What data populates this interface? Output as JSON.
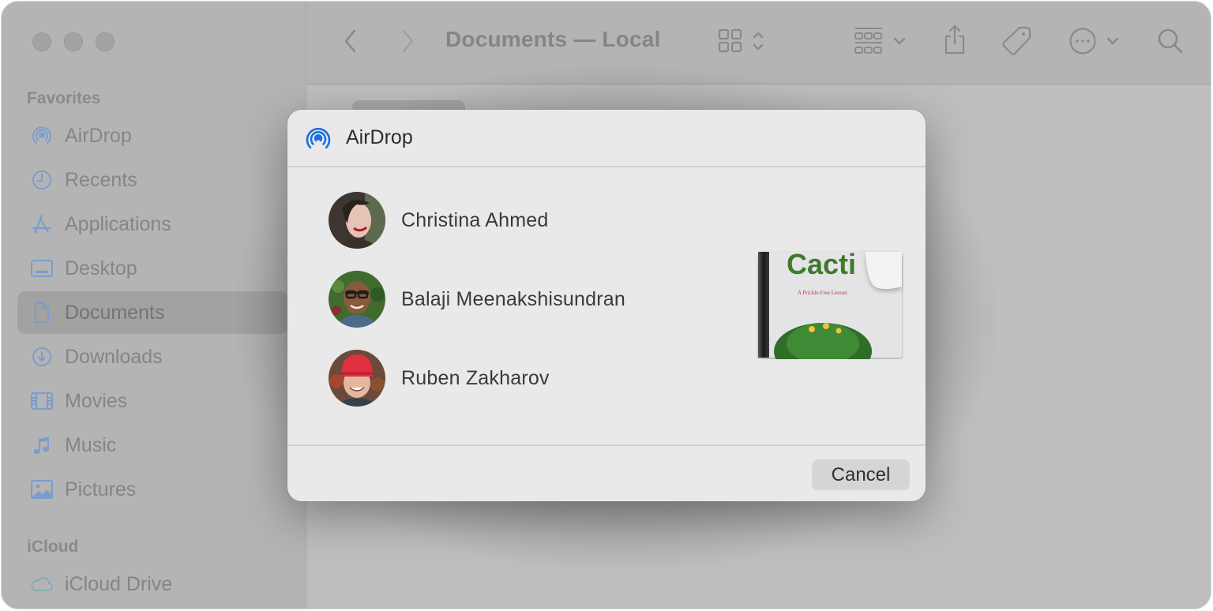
{
  "window": {
    "title": "Documents — Local",
    "traffic_lights": [
      "close",
      "minimize",
      "zoom"
    ]
  },
  "sidebar": {
    "sections": [
      {
        "label": "Favorites",
        "items": [
          {
            "label": "AirDrop",
            "icon": "airdrop-icon",
            "selected": false
          },
          {
            "label": "Recents",
            "icon": "clock-icon",
            "selected": false
          },
          {
            "label": "Applications",
            "icon": "applications-icon",
            "selected": false
          },
          {
            "label": "Desktop",
            "icon": "desktop-icon",
            "selected": false
          },
          {
            "label": "Documents",
            "icon": "document-icon",
            "selected": true
          },
          {
            "label": "Downloads",
            "icon": "download-icon",
            "selected": false
          },
          {
            "label": "Movies",
            "icon": "film-icon",
            "selected": false
          },
          {
            "label": "Music",
            "icon": "music-note-icon",
            "selected": false
          },
          {
            "label": "Pictures",
            "icon": "photo-icon",
            "selected": false
          }
        ]
      },
      {
        "label": "iCloud",
        "items": [
          {
            "label": "iCloud Drive",
            "icon": "cloud-icon",
            "selected": false
          }
        ]
      }
    ]
  },
  "toolbar": {
    "back": "chevron-left-icon",
    "forward": "chevron-right-icon",
    "view_mode": "grid-icon",
    "group_by": "group-icon",
    "share": "share-icon",
    "tags": "tag-icon",
    "more": "ellipsis-circle-icon",
    "search": "search-icon"
  },
  "dialog": {
    "title": "AirDrop",
    "icon": "airdrop-icon",
    "accent": "#1a6fe0",
    "people": [
      {
        "name": "Christina Ahmed"
      },
      {
        "name": "Balaji Meenakshisundran"
      },
      {
        "name": "Ruben Zakharov"
      }
    ],
    "file_preview": {
      "title": "Cacti",
      "subtitle": "A Prickle-Free Lesson"
    },
    "cancel_label": "Cancel"
  }
}
